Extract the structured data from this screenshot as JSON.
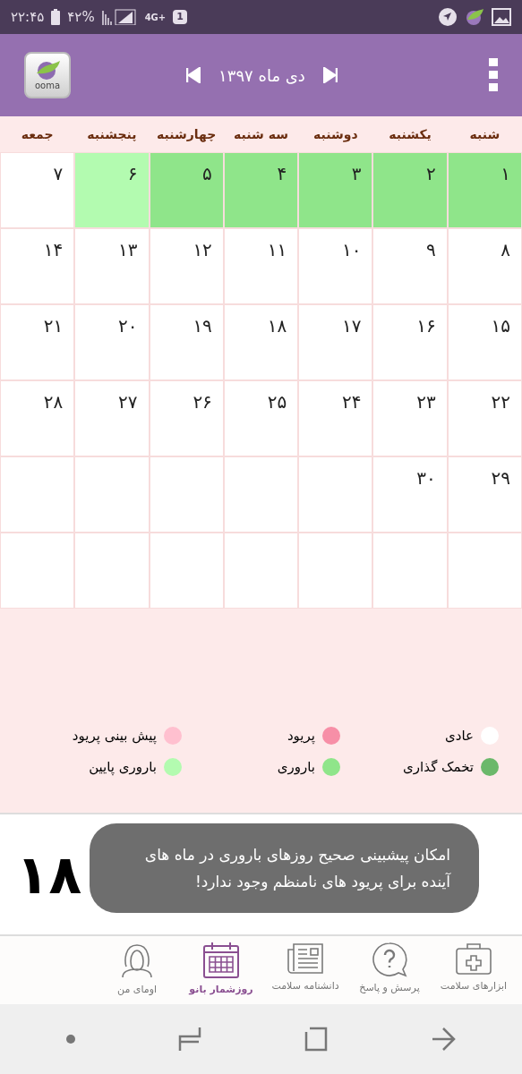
{
  "status_bar": {
    "time": "۲۲:۴۵",
    "battery": "۴۲%",
    "network": "4G+",
    "sim": "1"
  },
  "header": {
    "title": "دی ماه ۱۳۹۷",
    "logo_text": "ooma"
  },
  "weekdays": [
    "شنبه",
    "یکشنبه",
    "دوشنبه",
    "سه شنبه",
    "چهارشنبه",
    "پنجشنبه",
    "جمعه"
  ],
  "weeks": [
    [
      {
        "day": "۱",
        "kind": "fertile"
      },
      {
        "day": "۲",
        "kind": "fertile"
      },
      {
        "day": "۳",
        "kind": "fertile"
      },
      {
        "day": "۴",
        "kind": "fertile"
      },
      {
        "day": "۵",
        "kind": "fertile"
      },
      {
        "day": "۶",
        "kind": "low"
      },
      {
        "day": "۷",
        "kind": "normal"
      }
    ],
    [
      {
        "day": "۸",
        "kind": "normal"
      },
      {
        "day": "۹",
        "kind": "normal"
      },
      {
        "day": "۱۰",
        "kind": "normal"
      },
      {
        "day": "۱۱",
        "kind": "normal"
      },
      {
        "day": "۱۲",
        "kind": "normal"
      },
      {
        "day": "۱۳",
        "kind": "normal"
      },
      {
        "day": "۱۴",
        "kind": "normal"
      }
    ],
    [
      {
        "day": "۱۵",
        "kind": "normal"
      },
      {
        "day": "۱۶",
        "kind": "normal"
      },
      {
        "day": "۱۷",
        "kind": "normal"
      },
      {
        "day": "۱۸",
        "kind": "normal"
      },
      {
        "day": "۱۹",
        "kind": "normal"
      },
      {
        "day": "۲۰",
        "kind": "normal"
      },
      {
        "day": "۲۱",
        "kind": "normal"
      }
    ],
    [
      {
        "day": "۲۲",
        "kind": "normal"
      },
      {
        "day": "۲۳",
        "kind": "normal"
      },
      {
        "day": "۲۴",
        "kind": "normal"
      },
      {
        "day": "۲۵",
        "kind": "normal"
      },
      {
        "day": "۲۶",
        "kind": "normal"
      },
      {
        "day": "۲۷",
        "kind": "normal"
      },
      {
        "day": "۲۸",
        "kind": "normal"
      }
    ],
    [
      {
        "day": "۲۹",
        "kind": "normal"
      },
      {
        "day": "۳۰",
        "kind": "normal"
      }
    ]
  ],
  "legend": [
    {
      "label": "عادی",
      "color": "#ffffff"
    },
    {
      "label": "پریود",
      "color": "#f78fa7"
    },
    {
      "label": "پیش بینی پریود",
      "color": "#ffc0cf"
    },
    {
      "label": "تخمک گذاری",
      "color": "#6bb86a"
    },
    {
      "label": "باروری",
      "color": "#8fe58a"
    },
    {
      "label": "باروری پایین",
      "color": "#b3fbb0"
    }
  ],
  "today": {
    "day": "۱۸"
  },
  "toast": "امکان پیشبینی صحیح روزهای باروری در ماه های آینده برای پریود های نامنظم وجود ندارد!",
  "tabs": [
    {
      "label": "ابزارهای سلامت",
      "kind": "kit",
      "selected": false
    },
    {
      "label": "پرسش و پاسخ",
      "kind": "question",
      "selected": false
    },
    {
      "label": "دانشنامه سلامت",
      "kind": "news",
      "selected": false
    },
    {
      "label": "روزشمار بانو",
      "kind": "calendar",
      "selected": true
    },
    {
      "label": "اومای من",
      "kind": "person",
      "selected": false
    }
  ]
}
